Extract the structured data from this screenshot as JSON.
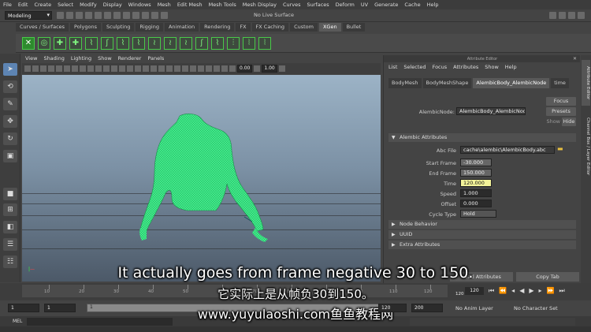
{
  "menubar": {
    "items": [
      "File",
      "Edit",
      "Create",
      "Select",
      "Modify",
      "Display",
      "Windows",
      "Mesh",
      "Edit Mesh",
      "Mesh Tools",
      "Mesh Display",
      "Curves",
      "Surfaces",
      "Deform",
      "UV",
      "Generate",
      "Cache",
      "Help"
    ]
  },
  "statusline": {
    "mode": "Modeling",
    "live_surface": "No Live Surface"
  },
  "shelf": {
    "tabs": [
      "Curves / Surfaces",
      "Polygons",
      "Sculpting",
      "Rigging",
      "Animation",
      "Rendering",
      "FX",
      "FX Caching",
      "Custom",
      "XGen",
      "Bullet"
    ],
    "active_tab": "XGen"
  },
  "panel": {
    "menus": [
      "View",
      "Shading",
      "Lighting",
      "Show",
      "Renderer",
      "Panels"
    ],
    "field_a": "0.00",
    "field_b": "1.00"
  },
  "attribute_editor": {
    "title": "Attribute Editor",
    "menus": [
      "List",
      "Selected",
      "Focus",
      "Attributes",
      "Show",
      "Help"
    ],
    "tabs": [
      "BodyMesh",
      "BodyMeshShape",
      "AlembicBody_AlembicNode",
      "time"
    ],
    "active_tab": "AlembicBody_AlembicNode",
    "node_label": "AlembicNode:",
    "node_value": "AlembicBody_AlembicNode",
    "focus_btn": "Focus",
    "presets_btn": "Presets",
    "show_label": "Show",
    "hide_btn": "Hide",
    "section_alembic": "Alembic Attributes",
    "abc_file_label": "Abc File",
    "abc_file_value": "cache\\alembic\\AlembicBody.abc",
    "start_frame_label": "Start Frame",
    "start_frame_value": "-30.000",
    "end_frame_label": "End Frame",
    "end_frame_value": "150.000",
    "time_label": "Time",
    "time_value": "120.000",
    "speed_label": "Speed",
    "speed_value": "1.000",
    "offset_label": "Offset",
    "offset_value": "0.000",
    "cycle_type_label": "Cycle Type",
    "cycle_type_value": "Hold",
    "section_node_behavior": "Node Behavior",
    "section_uuid": "UUID",
    "section_extra": "Extra Attributes",
    "load_attributes_btn": "Load Attributes",
    "copy_tab_btn": "Copy Tab"
  },
  "side_tabs": [
    "Attribute Editor",
    "Channel Box / Layer Editor"
  ],
  "timeslider": {
    "ticks": [
      "10",
      "20",
      "30",
      "40",
      "50",
      "60",
      "70",
      "80",
      "90",
      "100",
      "110",
      "120"
    ],
    "current_marker": "120",
    "current_frame": "120"
  },
  "rangeslider": {
    "start": "1",
    "playback_start": "1",
    "range_start_label": "1",
    "playback_end": "120",
    "end": "200",
    "anim_layer": "No Anim Layer",
    "character_set": "No Character Set"
  },
  "cmdline": {
    "label": "MEL"
  },
  "captions": {
    "english": "It actually goes from frame negative 30 to 150.",
    "chinese": "它实际上是从帧负30到150。",
    "watermark": "www.yuyulaoshi.com鱼鱼教程网"
  },
  "colors": {
    "accent_green": "#3fdc3f",
    "mesh_green": "#3ff08a",
    "time_highlight": "#f3f39a",
    "selection_blue": "#5d84b3"
  }
}
